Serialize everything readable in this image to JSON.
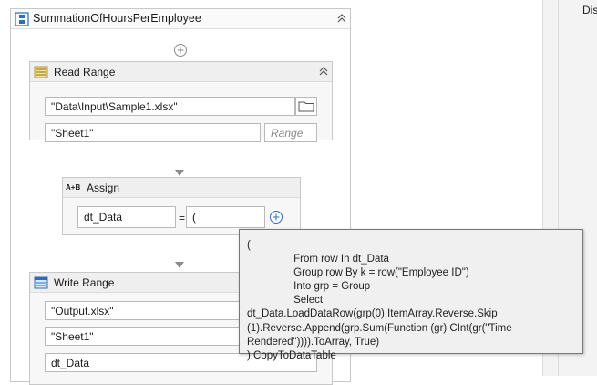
{
  "sequence": {
    "title": "SummationOfHoursPerEmployee"
  },
  "read_range": {
    "title": "Read Range",
    "workbook_path": "\"Data\\Input\\Sample1.xlsx\"",
    "sheet_name": "\"Sheet1\"",
    "range_placeholder": "Range"
  },
  "assign": {
    "title": "Assign",
    "icon_text": "A+B",
    "to": "dt_Data",
    "equals": "=",
    "value": "("
  },
  "write_range": {
    "title": "Write Range",
    "workbook_path": "\"Output.xlsx\"",
    "sheet_name": "\"Sheet1\"",
    "datatable": "dt_Data"
  },
  "tooltip": {
    "lines": [
      "(",
      "                From row In dt_Data",
      "                Group row By k = row(\"Employee ID\")",
      "                Into grp = Group",
      "                Select dt_Data.LoadDataRow(grp(0).ItemArray.Reverse.Skip",
      "(1).Reverse.Append(grp.Sum(Function (gr) CInt(gr(\"Time",
      "Rendered\")))).ToArray, True)",
      ").CopyToDataTable"
    ]
  },
  "right_panel": {
    "label": "Dis"
  },
  "icons": {
    "sequence": "sequence-icon",
    "collapse": "chevron-double-up-icon",
    "add": "plus-circle-icon",
    "read_range": "excel-read-range-icon",
    "folder": "folder-icon",
    "assign": "assign-icon",
    "expression": "plus-circle-icon",
    "write_range": "write-range-icon"
  },
  "colors": {
    "accent": "#2d6fb5",
    "border": "#c8c8c8",
    "tooltip_bg": "#f0f0f0"
  }
}
